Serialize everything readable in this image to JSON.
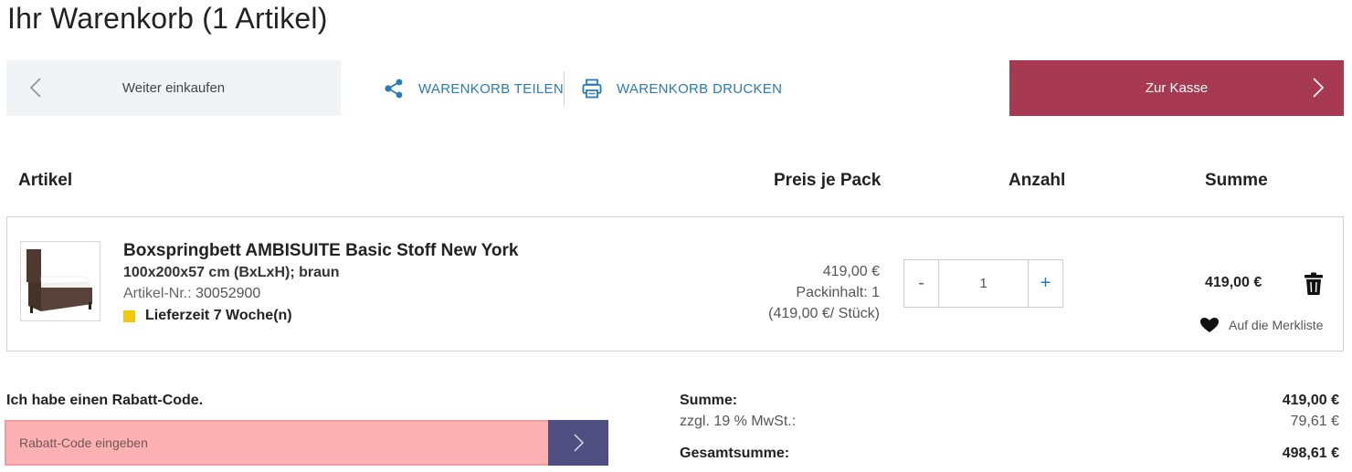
{
  "page": {
    "title": "Ihr Warenkorb (1 Artikel)"
  },
  "toolbar": {
    "continue_label": "Weiter einkaufen",
    "share_label": "WARENKORB TEILEN",
    "print_label": "WARENKORB DRUCKEN",
    "checkout_label": "Zur Kasse"
  },
  "table": {
    "headers": {
      "article": "Artikel",
      "price": "Preis je Pack",
      "qty": "Anzahl",
      "sum": "Summe"
    }
  },
  "cart_item": {
    "name": "Boxspringbett AMBISUITE Basic Stoff New York",
    "dimensions": "100x200x57 cm (BxLxH); braun",
    "article_nr_label": "Artikel-Nr.:",
    "article_nr": "30052900",
    "delivery": "Lieferzeit 7 Woche(n)",
    "price": "419,00 €",
    "pack_content": "Packinhalt: 1",
    "unit_price": "(419,00 €/ Stück)",
    "qty_minus": "-",
    "qty_value": "1",
    "qty_plus": "+",
    "sum": "419,00 €",
    "wishlist_label": "Auf die Merkliste",
    "image_icon": "boxspring-bed-image"
  },
  "coupon": {
    "label": "Ich habe einen Rabatt-Code.",
    "placeholder": "Rabatt-Code eingeben"
  },
  "totals": {
    "subtotal_label": "Summe:",
    "subtotal": "419,00 €",
    "vat_label": "zzgl. 19 % MwSt.:",
    "vat": "79,61 €",
    "grand_label": "Gesamtsumme:",
    "grand": "498,61 €"
  },
  "colors": {
    "checkout": "#a73a52",
    "link": "#2a7ab8",
    "coupon_input": "#feb1b2",
    "coupon_button": "#4f4f82",
    "delivery_marker": "#f2c811"
  }
}
